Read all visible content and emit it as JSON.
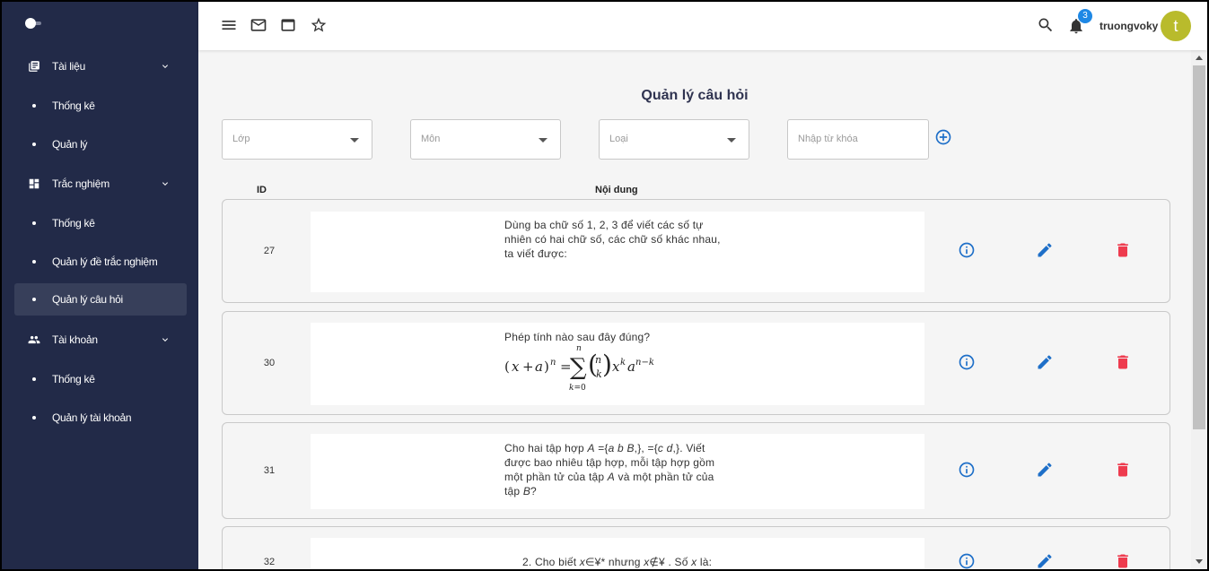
{
  "sidebar": {
    "groups": [
      {
        "label": "Tài liệu",
        "icon": "library-books-icon",
        "items": [
          "Thống kê",
          "Quản lý"
        ]
      },
      {
        "label": "Trắc nghiệm",
        "icon": "dashboard-icon",
        "items": [
          "Thống kê",
          "Quản lý đề trắc nghiệm",
          "Quản lý câu hỏi"
        ]
      },
      {
        "label": "Tài khoản",
        "icon": "people-icon",
        "items": [
          "Thống kê",
          "Quản lý tài khoản"
        ]
      }
    ],
    "active_item": "Quản lý câu hỏi"
  },
  "topbar": {
    "icons": [
      "menu-icon",
      "mail-icon",
      "window-icon",
      "star-icon",
      "search-icon",
      "bell-icon"
    ],
    "notification_count": "3",
    "username": "truongvoky",
    "avatar_letter": "t"
  },
  "page": {
    "title": "Quản lý câu hỏi",
    "filters": {
      "class_placeholder": "Lớp",
      "subject_placeholder": "Môn",
      "type_placeholder": "Loại",
      "keyword_placeholder": "Nhập từ khóa"
    },
    "columns": {
      "id": "ID",
      "content": "Nội dung"
    },
    "questions": [
      {
        "id": "27",
        "text": "Dùng ba chữ số 1, 2, 3 để viết các số tự nhiên có hai chữ số, các chữ số khác nhau, ta viết được:"
      },
      {
        "id": "30",
        "text": "Phép tính nào sau đây đúng?",
        "formula": "(x + a)^n = Σ_{k=0}^{n} C(n,k) x^k a^{n−k}"
      },
      {
        "id": "31",
        "text_parts": [
          "Cho hai tập hợp ",
          "A",
          " ={",
          "a b B",
          ",},   ={",
          "c d",
          ",}. Viết được bao nhiêu tập hợp, mỗi tập hợp gồm một phần tử của tập ",
          "A",
          " và một phần tử của tập ",
          "B",
          "?"
        ]
      },
      {
        "id": "32",
        "text_parts": [
          "2. Cho biết ",
          "x",
          "∈¥* nhưng ",
          "x",
          "∉¥ . Số ",
          "x",
          " là:"
        ]
      }
    ]
  },
  "colors": {
    "sidebar_bg": "#222a48",
    "info": "#1e6fc8",
    "edit": "#1e6fc8",
    "delete": "#ee3b4e",
    "avatar": "#b9bb2c"
  }
}
